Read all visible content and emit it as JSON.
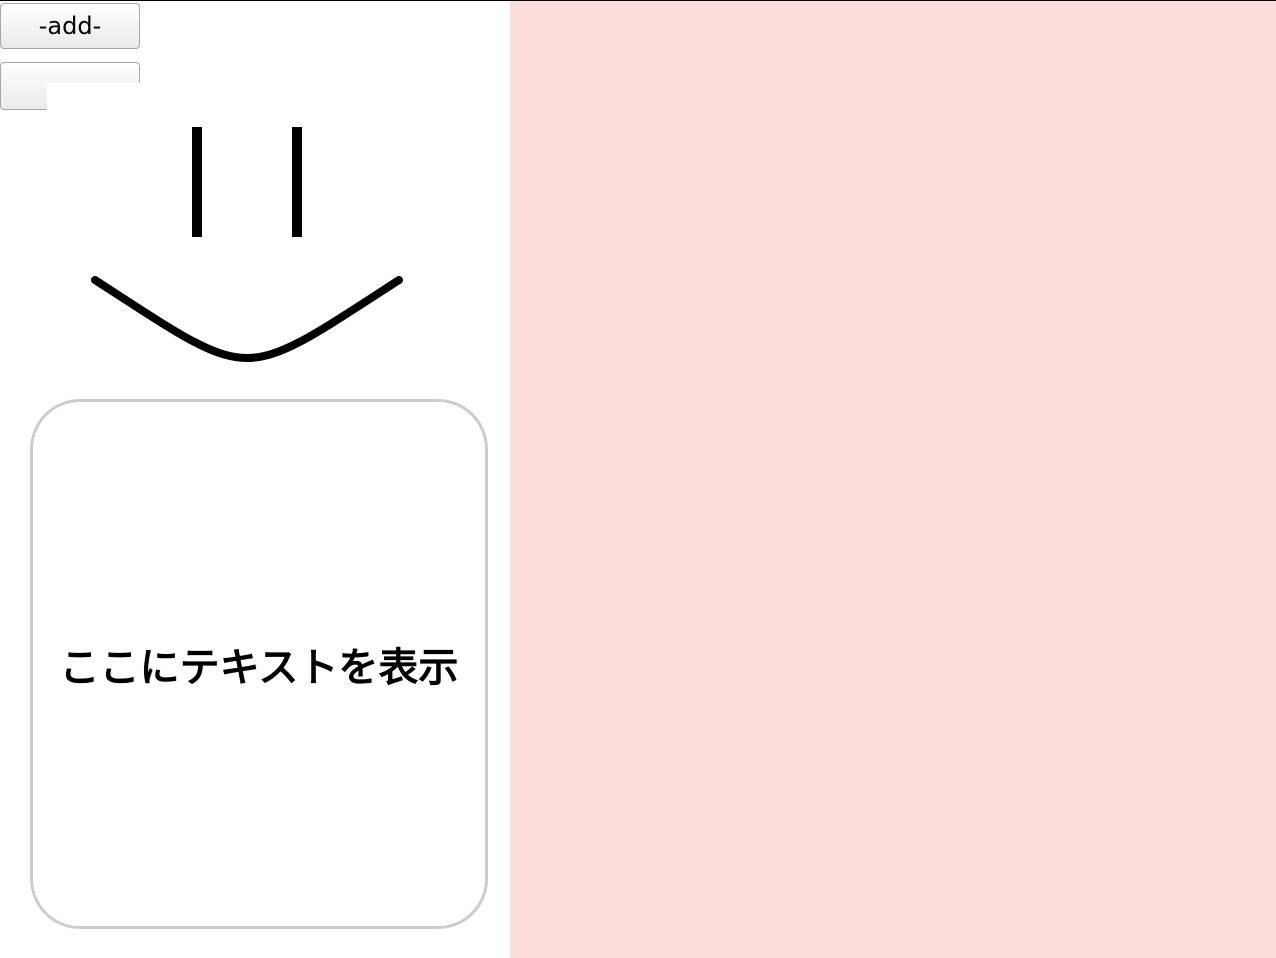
{
  "toolbar": {
    "add_label": "-add-",
    "second_label": "-"
  },
  "face": {
    "icon": "smiley-face-icon",
    "stroke_color": "#000000"
  },
  "card": {
    "text": "ここにテキストを表示"
  },
  "colors": {
    "right_pane": "#fddcdc",
    "card_border": "#cccccc"
  }
}
